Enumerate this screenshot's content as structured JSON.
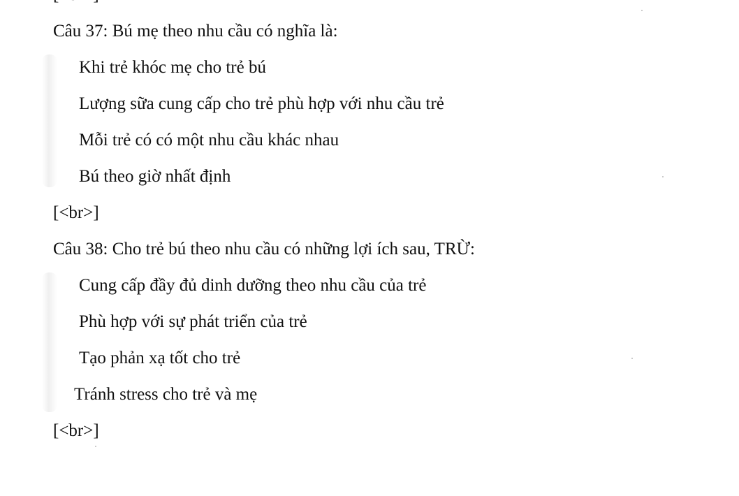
{
  "top_fragment": "[<br>]",
  "questions": [
    {
      "prompt": "Câu 37: Bú mẹ theo nhu cầu có nghĩa là:",
      "options": [
        "Khi trẻ khóc mẹ cho trẻ bú",
        "Lượng sữa cung cấp cho trẻ phù hợp với nhu cầu trẻ",
        "Mỗi trẻ có có một nhu cầu khác nhau",
        "Bú theo giờ nhất định"
      ],
      "separator": "[<br>]"
    },
    {
      "prompt": "Câu 38: Cho trẻ bú theo nhu cầu có những lợi ích sau, TRỪ:",
      "options": [
        "Cung cấp đầy đủ dinh dưỡng theo nhu cầu của trẻ",
        "Phù hợp với sự phát triển của trẻ",
        "Tạo phản xạ tốt cho trẻ",
        "Tránh stress cho trẻ và mẹ"
      ],
      "separator": "[<br>]"
    }
  ]
}
